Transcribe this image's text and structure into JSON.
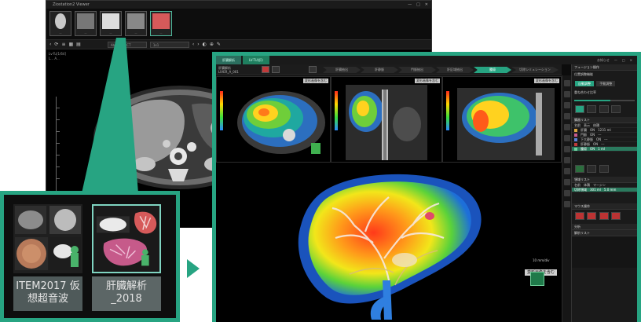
{
  "back_window": {
    "title": "Ziostation2 Viewer",
    "window_controls": [
      "—",
      "□",
      "✕"
    ],
    "thumbnails": [
      {
        "label": "…"
      },
      {
        "label": "…"
      },
      {
        "label": "…"
      },
      {
        "label": "…"
      },
      {
        "label": "…"
      }
    ],
    "toolbar": {
      "preset": "Abdomen CT",
      "layout": "1x1"
    },
    "meta_lines": [
      "Lv-Tu[1/64]",
      "",
      "L... A..."
    ]
  },
  "callout": {
    "tiles": [
      {
        "name": "ITEM2017 仮想超音波"
      },
      {
        "name": "肝臓解析_2018"
      }
    ]
  },
  "front_window": {
    "tabs": [
      "肝臓解析",
      "LV-TU(肝)"
    ],
    "title_right": [
      "お知らせ",
      "—",
      "□",
      "✕"
    ],
    "left_label": [
      "肝臓解析",
      "LIVER_A_001"
    ],
    "workflow_steps": [
      "肝臓抽出",
      "肝静脈",
      "門脈抽出",
      "肝区域抽出",
      "腫瘍",
      "切除シミュレーション"
    ],
    "active_step": 4,
    "viewport_tags": [
      "変形画像を含む",
      "変形画像を含む",
      "変形画像を含む"
    ],
    "big_tag": "変形画像を含む",
    "scale_label": "10 mm/div",
    "cube_label": "",
    "right_panel": {
      "header": "フュージョン操作",
      "section1": "位置調整機能",
      "buttons": [
        "自動調整",
        "手動調整"
      ],
      "opacity_label": "重ね合わせ比率",
      "list_header": "臓器リスト",
      "list_cols": [
        "名前",
        "表示",
        "体積"
      ],
      "list_rows": [
        {
          "name": "肝臓",
          "show": "ON",
          "vol": "1231 ml",
          "color": "#d9a441"
        },
        {
          "name": "門脈",
          "show": "ON",
          "vol": "---",
          "color": "#c75a8f"
        },
        {
          "name": "下大静脈",
          "show": "ON",
          "vol": "---",
          "color": "#5a7fd9"
        },
        {
          "name": "肝静脈",
          "show": "ON",
          "vol": "---",
          "color": "#c03a3a"
        },
        {
          "name": "腫瘍",
          "show": "ON",
          "vol": "1 ml",
          "color": "#6fd0a0"
        }
      ],
      "list2_header": "領域リスト",
      "list2_cols": [
        "名前",
        "体積",
        "マージン"
      ],
      "list2_row": {
        "name": "切除領域",
        "vol": "301 ml",
        "margin": "5.0 mm"
      },
      "mouse_header": "マウス操作",
      "section_list": "分析",
      "list3_header": "解析リスト"
    }
  }
}
